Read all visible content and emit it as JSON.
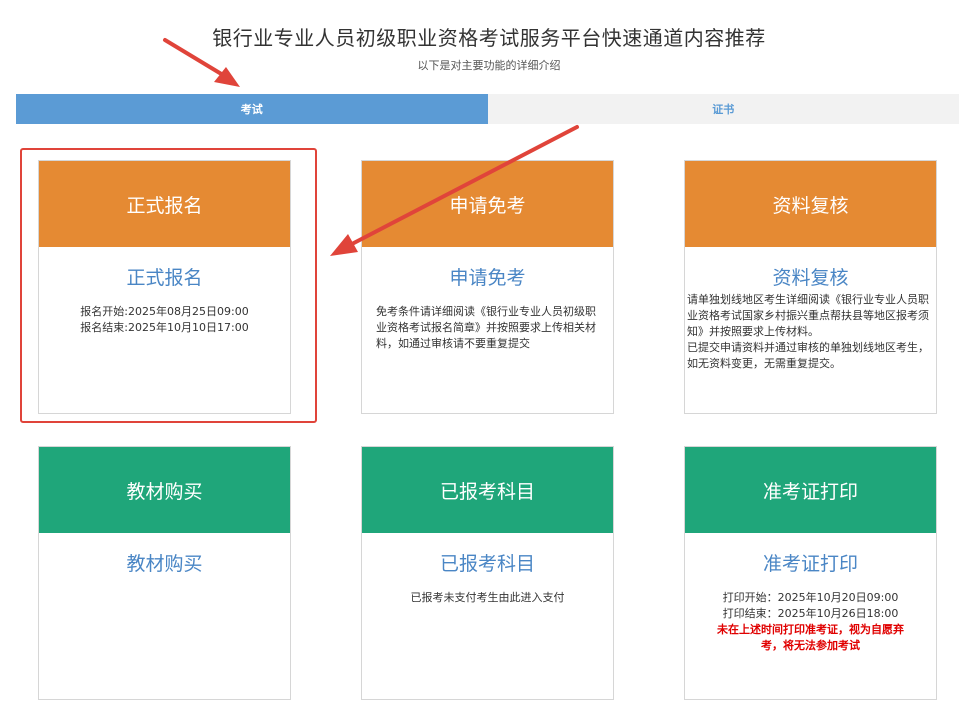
{
  "header": {
    "title": "银行业专业人员初级职业资格考试服务平台快速通道内容推荐",
    "subtitle": "以下是对主要功能的详细介绍"
  },
  "tabs": [
    {
      "label": "考试",
      "active": true
    },
    {
      "label": "证书",
      "active": false
    }
  ],
  "cards": [
    {
      "head": "正式报名",
      "sub": "正式报名",
      "lines": [
        "报名开始:2025年08月25日09:00",
        "报名结束:2025年10月10日17:00"
      ]
    },
    {
      "head": "申请免考",
      "sub": "申请免考",
      "text": "免考条件请详细阅读《银行业专业人员初级职业资格考试报名简章》并按照要求上传相关材料，如通过审核请不要重复提交"
    },
    {
      "head": "资料复核",
      "sub": "资料复核",
      "text1": "请单独划线地区考生详细阅读《银行业专业人员职业资格考试国家乡村振兴重点帮扶县等地区报考须知》并按照要求上传材料。",
      "text2": "已提交申请资料并通过审核的单独划线地区考生，如无资料变更，无需重复提交。"
    },
    {
      "head": "教材购买",
      "sub": "教材购买"
    },
    {
      "head": "已报考科目",
      "sub": "已报考科目",
      "text": "已报考未支付考生由此进入支付"
    },
    {
      "head": "准考证打印",
      "sub": "准考证打印",
      "lines": [
        "打印开始：2025年10月20日09:00",
        "打印结束：2025年10月26日18:00"
      ],
      "warning": "未在上述时间打印准考证，视为自愿弃考，将无法参加考试"
    }
  ],
  "colors": {
    "orange": "#e58a33",
    "green": "#1fa67a",
    "tab_active": "#5b9bd5",
    "highlight": "#e0443a",
    "warning": "#e00000"
  }
}
